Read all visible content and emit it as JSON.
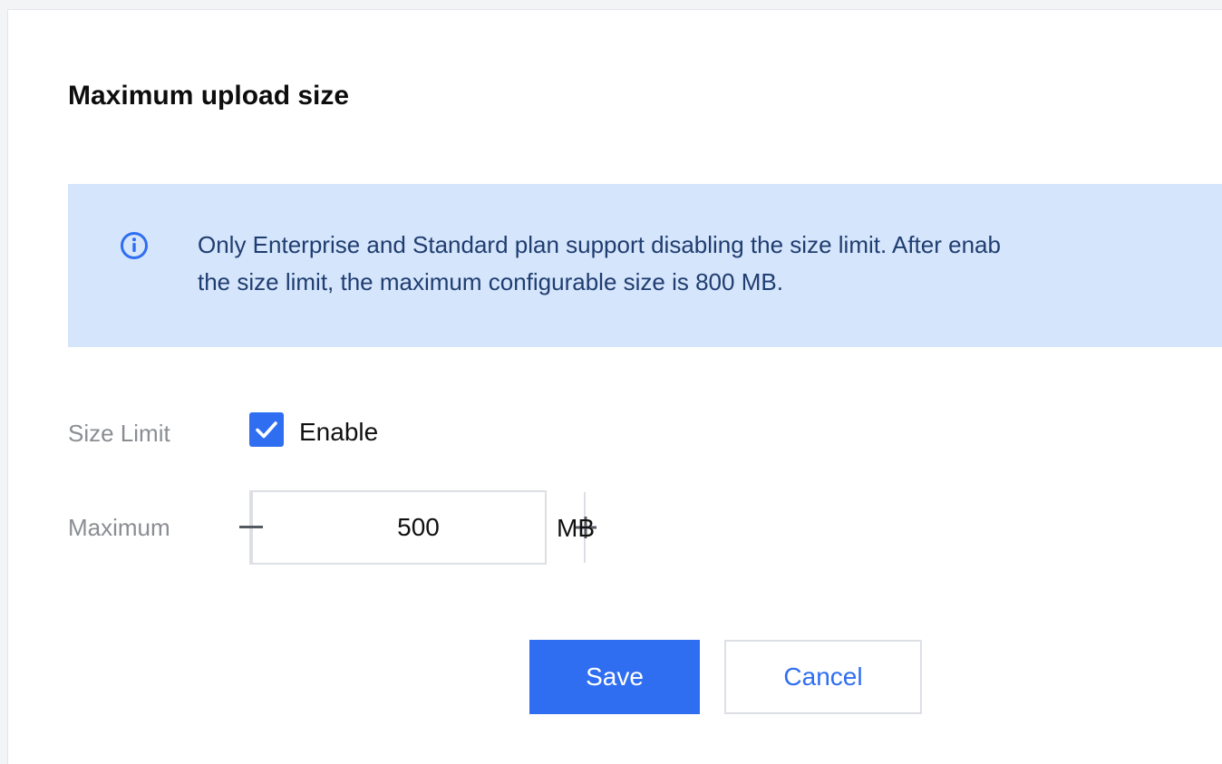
{
  "dialog": {
    "title": "Maximum upload size",
    "notice": {
      "icon": "info-circle-icon",
      "line1": "Only Enterprise and Standard plan support disabling the size limit. After enab",
      "line2": "the size limit, the maximum configurable size is 800 MB."
    },
    "size_limit": {
      "label": "Size Limit",
      "checkbox_checked": true,
      "checkbox_label": "Enable"
    },
    "maximum": {
      "label": "Maximum",
      "value": "500",
      "unit": "MB",
      "decrement_icon": "minus-icon",
      "increment_icon": "plus-icon"
    },
    "actions": {
      "save_label": "Save",
      "cancel_label": "Cancel"
    }
  },
  "colors": {
    "primary": "#2f6ef1",
    "notice_bg": "#d5e5fb",
    "notice_text": "#1f3d70",
    "label_gray": "#8a8d92",
    "border": "#dcdfe4"
  }
}
